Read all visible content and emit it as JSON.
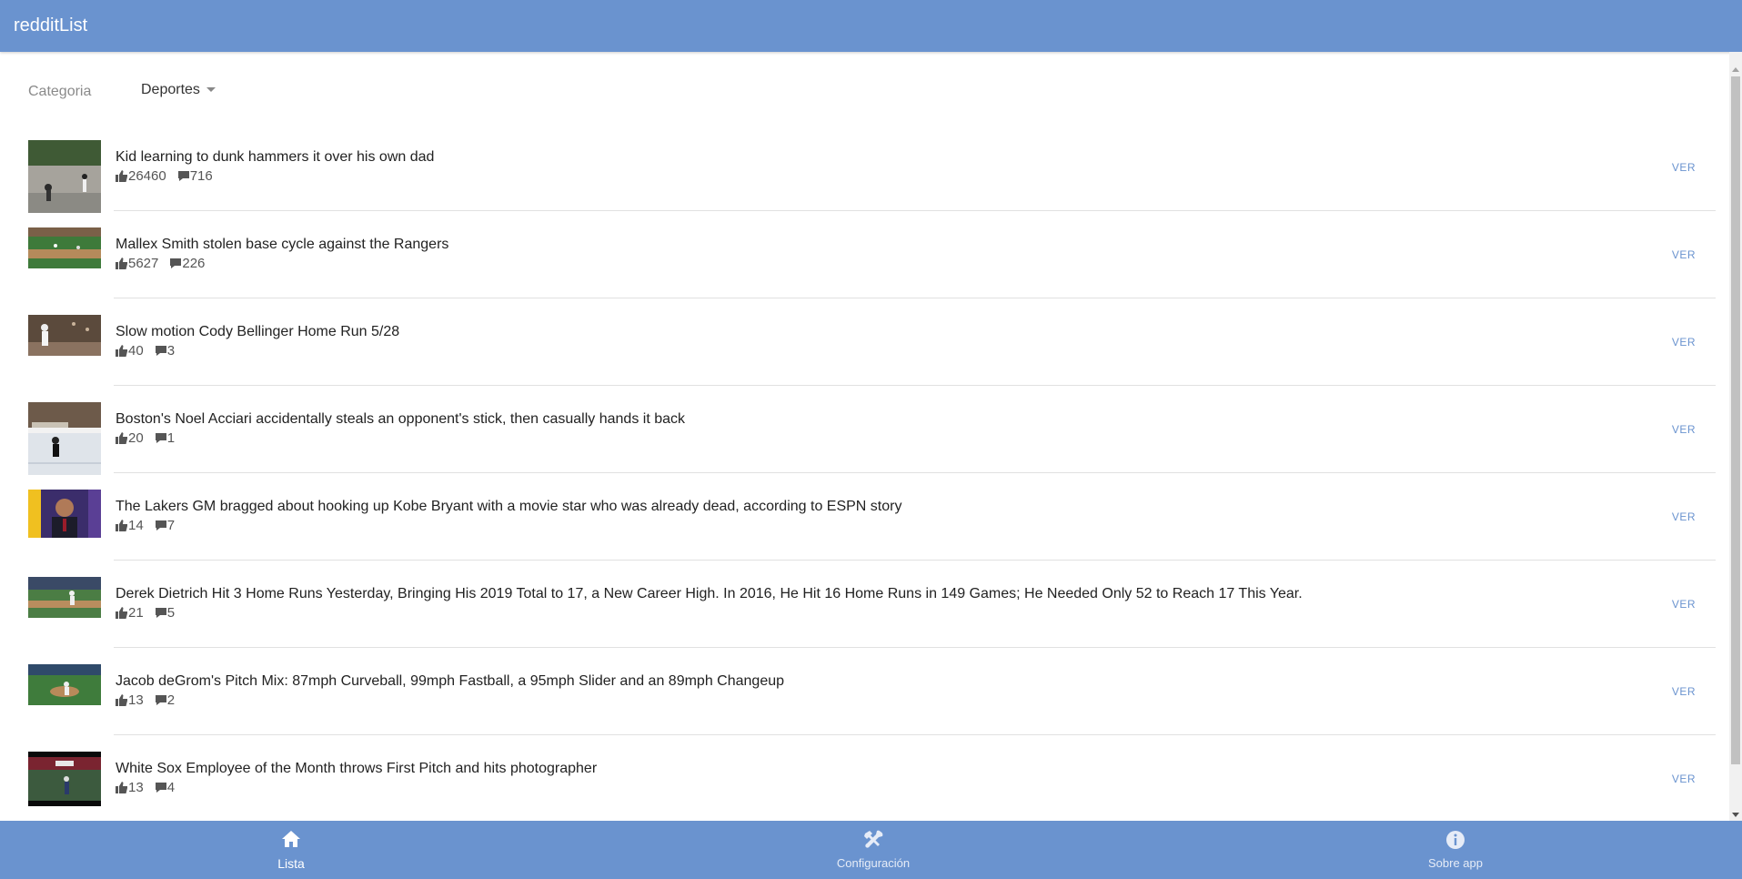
{
  "app": {
    "title": "redditList"
  },
  "filter": {
    "label": "Categoria",
    "selected": "Deportes"
  },
  "posts": [
    {
      "title": "Kid learning to dunk hammers it over his own dad",
      "likes": "26460",
      "comments": "716",
      "action": "VER"
    },
    {
      "title": "Mallex Smith stolen base cycle against the Rangers",
      "likes": "5627",
      "comments": "226",
      "action": "VER"
    },
    {
      "title": "Slow motion Cody Bellinger Home Run 5/28",
      "likes": "40",
      "comments": "3",
      "action": "VER"
    },
    {
      "title": "Boston's Noel Acciari accidentally steals an opponent's stick, then casually hands it back",
      "likes": "20",
      "comments": "1",
      "action": "VER"
    },
    {
      "title": "The Lakers GM bragged about hooking up Kobe Bryant with a movie star who was already dead, according to ESPN story",
      "likes": "14",
      "comments": "7",
      "action": "VER"
    },
    {
      "title": "Derek Dietrich Hit 3 Home Runs Yesterday, Bringing His 2019 Total to 17, a New Career High. In 2016, He Hit 16 Home Runs in 149 Games; He Needed Only 52 to Reach 17 This Year.",
      "likes": "21",
      "comments": "5",
      "action": "VER"
    },
    {
      "title": "Jacob deGrom's Pitch Mix: 87mph Curveball, 99mph Fastball, a 95mph Slider and an 89mph Changeup",
      "likes": "13",
      "comments": "2",
      "action": "VER"
    },
    {
      "title": "White Sox Employee of the Month throws First Pitch and hits photographer",
      "likes": "13",
      "comments": "4",
      "action": "VER"
    }
  ],
  "bottom_nav": {
    "tabs": [
      {
        "label": "Lista",
        "icon": "home-icon",
        "active": true
      },
      {
        "label": "Configuración",
        "icon": "tools-icon",
        "active": false
      },
      {
        "label": "Sobre app",
        "icon": "info-icon",
        "active": false
      }
    ]
  },
  "colors": {
    "primary": "#6a93cf",
    "link": "#6a93cf"
  }
}
